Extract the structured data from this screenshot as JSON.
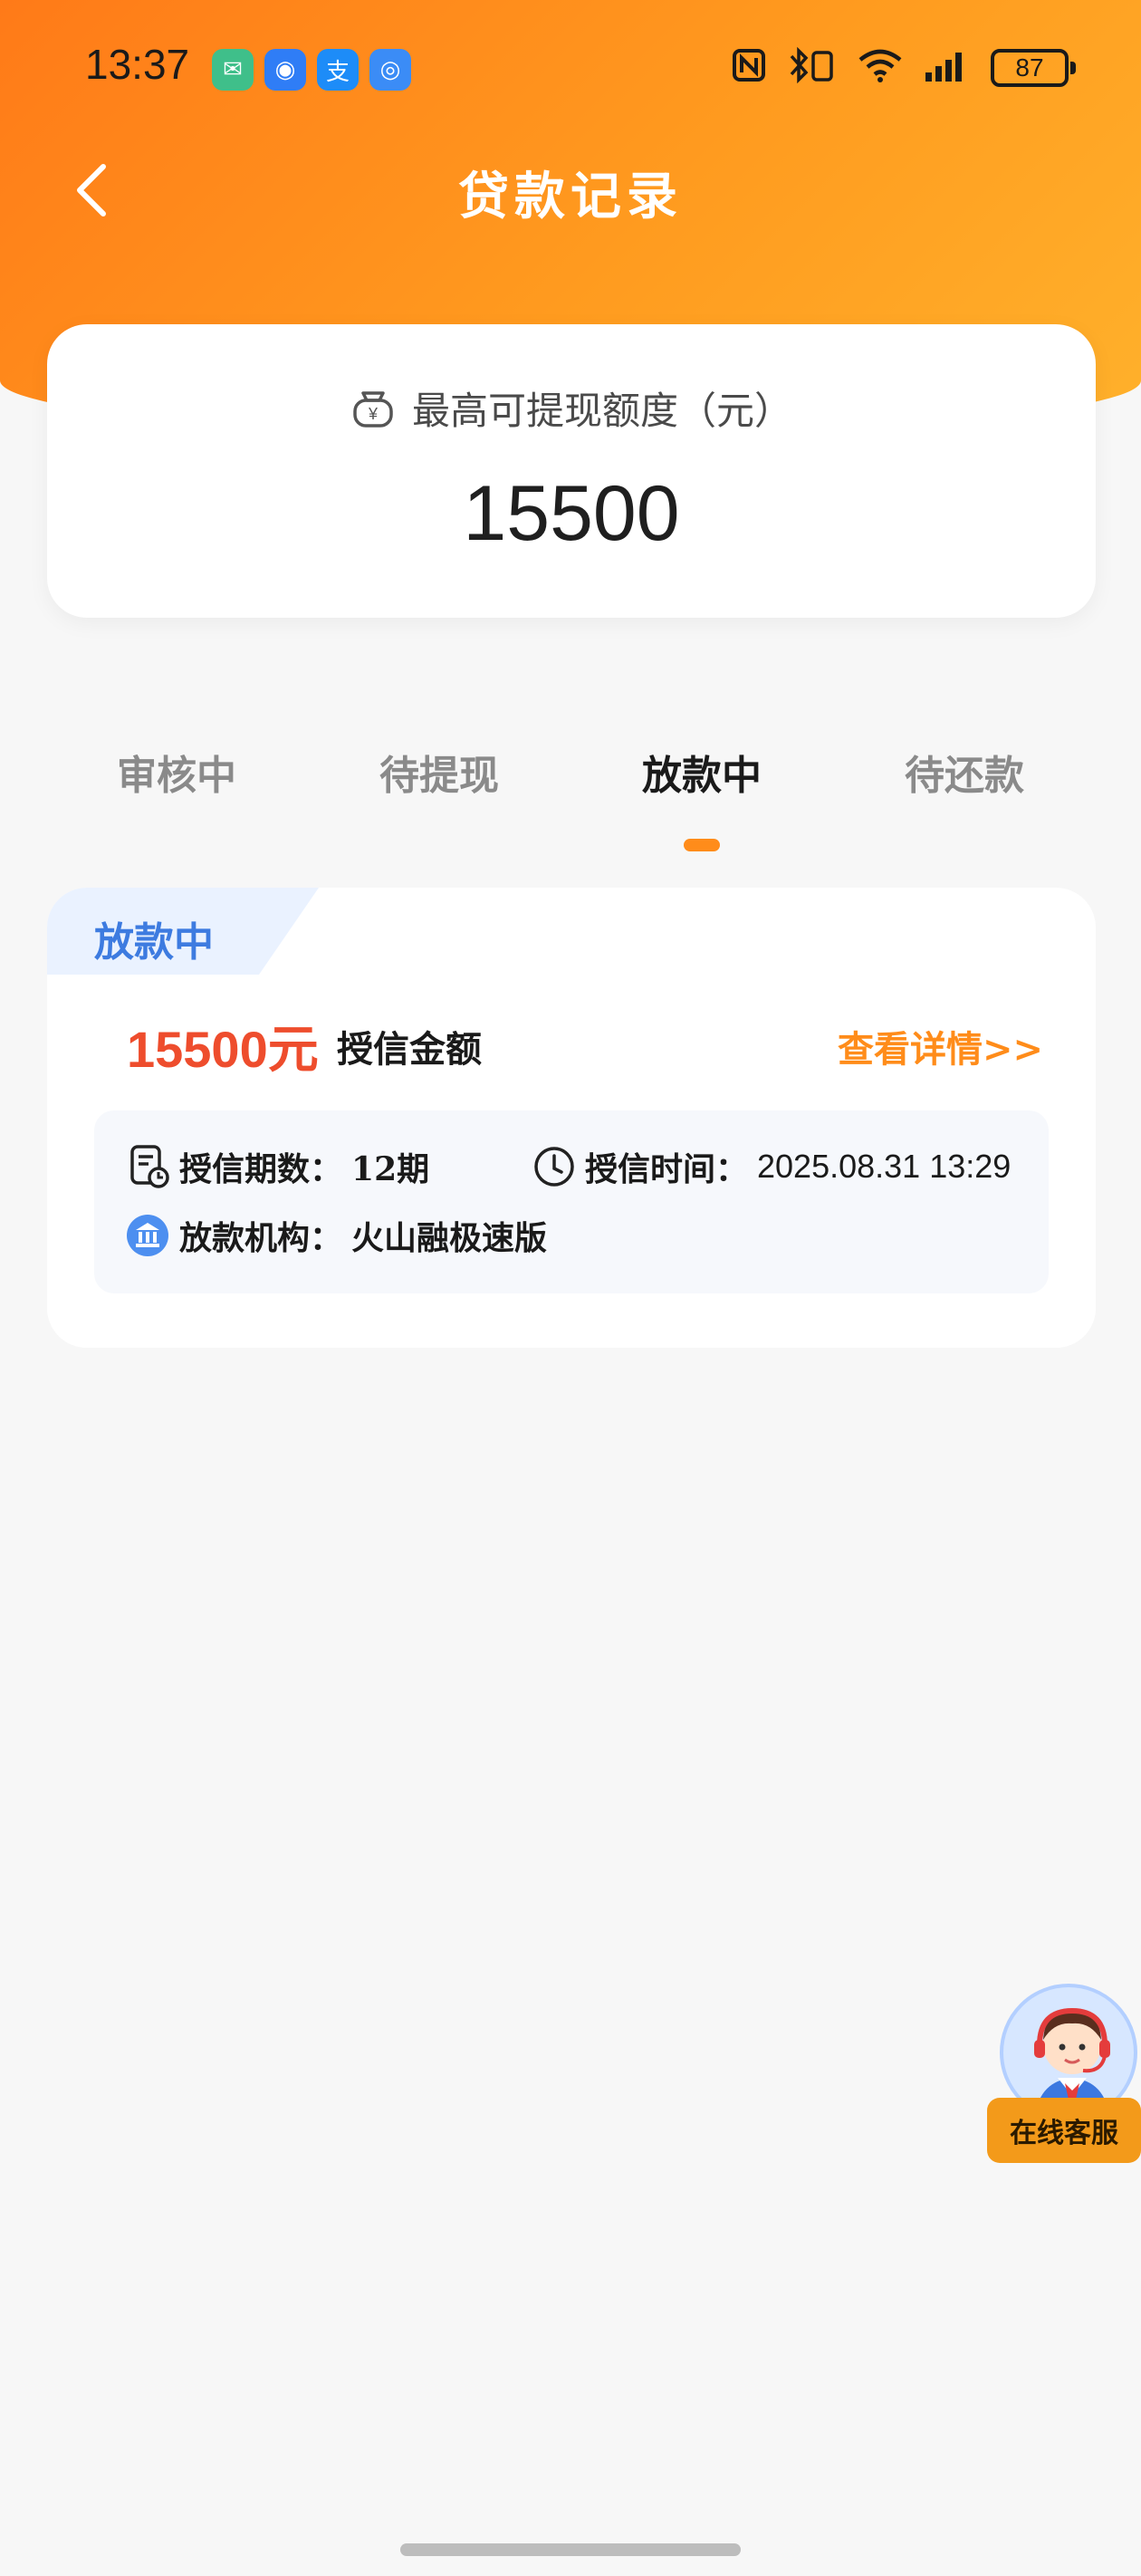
{
  "status": {
    "time": "13:37",
    "battery": "87",
    "apps": [
      {
        "icon": "message-app-icon",
        "color": "#3fbf8a",
        "glyph": "✉"
      },
      {
        "icon": "security-app-icon",
        "color": "#2f7df6",
        "glyph": "◉"
      },
      {
        "icon": "alipay-app-icon",
        "color": "#1d8cf8",
        "glyph": "支"
      },
      {
        "icon": "browser-app-icon",
        "color": "#3b8cf6",
        "glyph": "◎"
      }
    ]
  },
  "header": {
    "title": "贷款记录",
    "back_icon": "chevron-left-icon"
  },
  "quota": {
    "label": "最高可提现额度（元）",
    "value": "15500",
    "icon": "money-bag-icon"
  },
  "tabs": [
    {
      "label": "审核中",
      "active": false
    },
    {
      "label": "待提现",
      "active": false
    },
    {
      "label": "放款中",
      "active": true
    },
    {
      "label": "待还款",
      "active": false
    }
  ],
  "record": {
    "status_tag": "放款中",
    "amount": "15500元",
    "amount_label": "授信金额",
    "detail_link": "查看详情>>",
    "periods_key": "授信期数：",
    "periods_value": "12期",
    "time_key": "授信时间：",
    "time_value": "2025.08.31 13:29",
    "lender_key": "放款机构：",
    "lender_value": "火山融极速版"
  },
  "customer_service": {
    "label": "在线客服"
  },
  "colors": {
    "brand_orange": "#ff8c1a",
    "amount_red": "#ee4d2d",
    "tag_blue": "#3d7be0"
  }
}
